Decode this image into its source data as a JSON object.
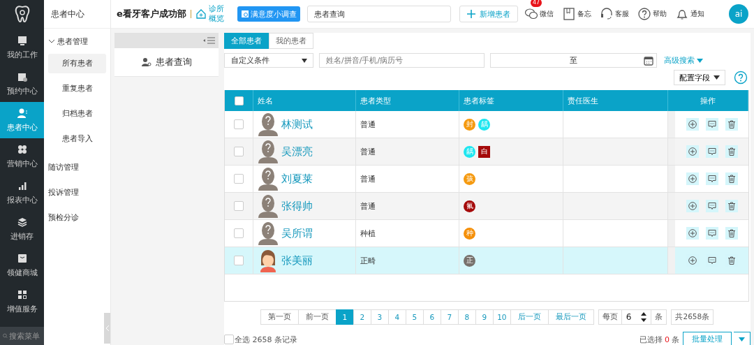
{
  "rail": {
    "items": [
      {
        "label": "我的工作",
        "selected": false
      },
      {
        "label": "预约中心",
        "selected": false
      },
      {
        "label": "患者中心",
        "selected": true
      },
      {
        "label": "营销中心",
        "selected": false
      },
      {
        "label": "报表中心",
        "selected": false
      },
      {
        "label": "进销存",
        "selected": false
      },
      {
        "label": "领健商城",
        "selected": false
      },
      {
        "label": "增值服务",
        "selected": false
      }
    ],
    "search": {
      "placeholder": "搜索菜单"
    }
  },
  "submenu": {
    "title": "患者中心",
    "groups": [
      {
        "label": "患者管理",
        "expanded": true,
        "children": [
          {
            "label": "所有患者",
            "selected": true
          },
          {
            "label": "重复患者",
            "selected": false
          },
          {
            "label": "归档患者",
            "selected": false
          },
          {
            "label": "患者导入",
            "selected": false
          }
        ]
      },
      {
        "label": "随访管理",
        "expanded": false
      },
      {
        "label": "投诉管理",
        "expanded": false
      },
      {
        "label": "预检分诊",
        "expanded": false
      }
    ]
  },
  "topbar": {
    "clinic": "e看牙客户成功部",
    "overview": "诊所概览",
    "survey": "满意度小调查",
    "search_value": "患者查询",
    "add_button": "新增患者",
    "tools": [
      {
        "label": "微信",
        "badge": "47"
      },
      {
        "label": "备忘"
      },
      {
        "label": "客服"
      },
      {
        "label": "帮助"
      },
      {
        "label": "通知"
      }
    ],
    "avatar": "ai"
  },
  "panel": {
    "item": "患者查询"
  },
  "tabs": [
    {
      "label": "全部患者",
      "selected": true
    },
    {
      "label": "我的患者",
      "selected": false
    }
  ],
  "filters": {
    "condition": "自定义条件",
    "keyword_placeholder": "姓名/拼音/手机/病历号",
    "date_separator": "至",
    "advanced": "高级搜索",
    "config": "配置字段"
  },
  "table": {
    "all_checked": false,
    "columns": [
      "姓名",
      "患者类型",
      "患者标签",
      "责任医生",
      "操作"
    ],
    "rows": [
      {
        "name": "林测试",
        "kind": "unknown",
        "type": "普通",
        "checked": false,
        "selected": false,
        "tags": [
          {
            "text": "封",
            "color": "#f59a10",
            "kind": "round"
          },
          {
            "text": "龋",
            "color": "#1ee6f0",
            "kind": "round"
          }
        ]
      },
      {
        "name": "吴漂亮",
        "kind": "unknown",
        "type": "普通",
        "checked": false,
        "selected": false,
        "tags": [
          {
            "text": "龋",
            "color": "#1ee6f0",
            "kind": "round"
          },
          {
            "text": "白",
            "color": "#a50a0a",
            "kind": "square"
          }
        ]
      },
      {
        "name": "刘夏莱",
        "kind": "unknown",
        "type": "普通",
        "checked": false,
        "selected": false,
        "tags": [
          {
            "text": "孩",
            "color": "#f59a10",
            "kind": "round"
          }
        ]
      },
      {
        "name": "张得帅",
        "kind": "unknown",
        "type": "普通",
        "checked": false,
        "selected": false,
        "tags": [
          {
            "text": "氟",
            "color": "#a50a0a",
            "kind": "round"
          }
        ]
      },
      {
        "name": "吴所谓",
        "kind": "unknown",
        "type": "种植",
        "checked": false,
        "selected": false,
        "tags": [
          {
            "text": "种",
            "color": "#f5900a",
            "kind": "round"
          }
        ]
      },
      {
        "name": "张美丽",
        "kind": "female",
        "type": "正畸",
        "checked": false,
        "selected": true,
        "tags": [
          {
            "text": "正",
            "color": "#77716c",
            "kind": "round"
          }
        ]
      }
    ]
  },
  "pagination": {
    "first": "第一页",
    "prev": "前一页",
    "pages": [
      {
        "label": "1",
        "selected": true
      },
      {
        "label": "2",
        "selected": false
      },
      {
        "label": "3",
        "selected": false
      },
      {
        "label": "4",
        "selected": false
      },
      {
        "label": "5",
        "selected": false
      },
      {
        "label": "6",
        "selected": false
      },
      {
        "label": "7",
        "selected": false
      },
      {
        "label": "8",
        "selected": false
      },
      {
        "label": "9",
        "selected": false
      },
      {
        "label": "10",
        "selected": false
      }
    ],
    "next": "后一页",
    "last": "最后一页",
    "per_page_label": "每页",
    "per_page": "6",
    "per_page_unit": "条",
    "total": "共2658条"
  },
  "footer": {
    "select_all_checked": false,
    "select_all": "全选 2658 条记录",
    "selected_label": "已选择",
    "selected_count": "0",
    "selected_unit": "条",
    "batch": "批量处理"
  }
}
